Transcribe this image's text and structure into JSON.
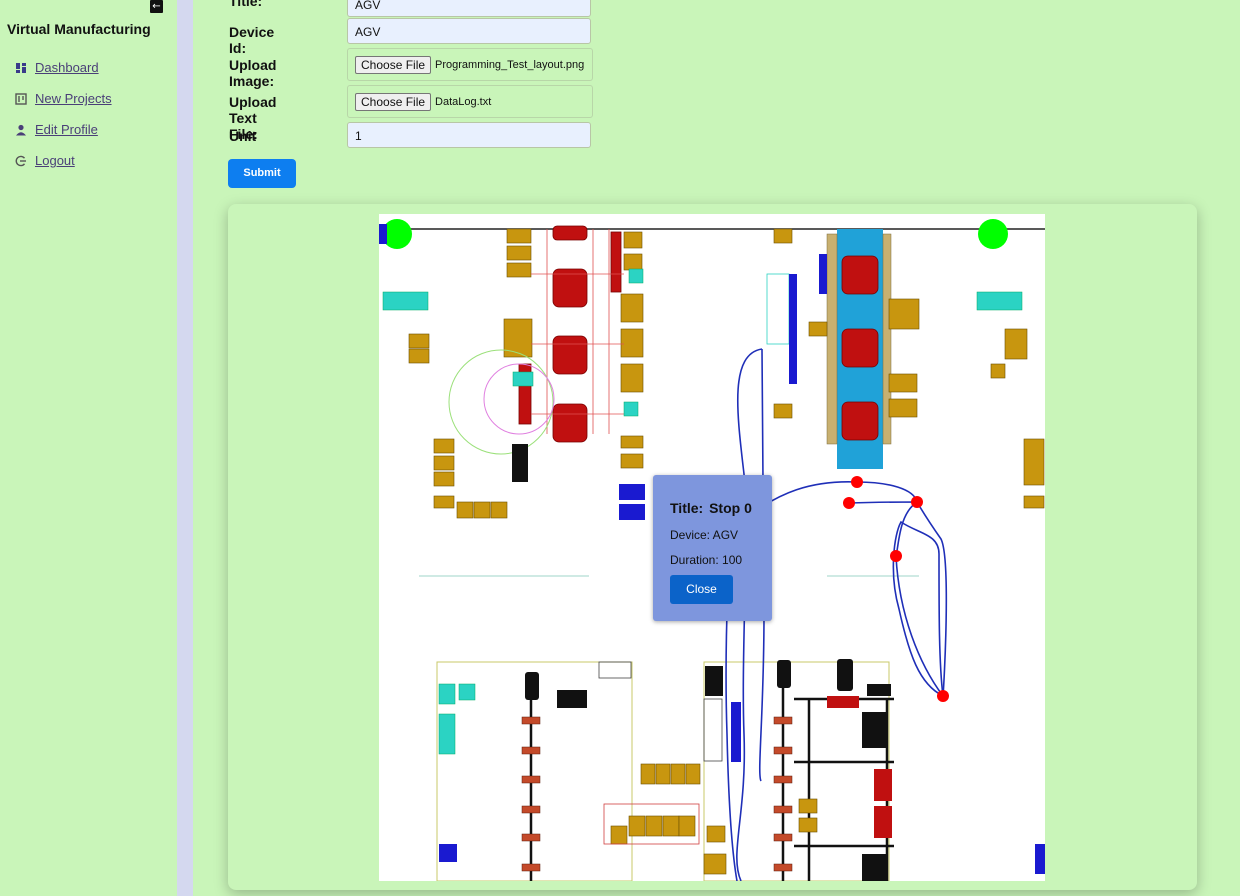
{
  "sidebar": {
    "app_title": "Virtual Manufacturing",
    "items": [
      {
        "label": "Dashboard",
        "icon": "dashboard-icon"
      },
      {
        "label": "New Projects",
        "icon": "projects-icon"
      },
      {
        "label": "Edit Profile",
        "icon": "user-icon"
      },
      {
        "label": "Logout",
        "icon": "logout-icon"
      }
    ]
  },
  "form": {
    "title_label": "Title:",
    "title_value": "AGV",
    "device_label": "Device Id:",
    "device_value": "AGV",
    "image_label": "Upload Image:",
    "image_button": "Choose File",
    "image_file": "Programming_Test_layout.png",
    "text_label": "Upload Text File:",
    "text_button": "Choose File",
    "text_file": "DataLog.txt",
    "unit_label": "Unit",
    "unit_value": "1",
    "submit_label": "Submit"
  },
  "popup": {
    "title_label": "Title:",
    "title_value": "Stop 0",
    "device_text": "Device: AGV",
    "duration_text": "Duration: 100",
    "close_label": "Close"
  },
  "colors": {
    "background": "#c9f5b9",
    "accent": "#0d7ef0",
    "popup": "#7e96dd",
    "path": "#1f2fb8",
    "stop": "#ff0000"
  }
}
